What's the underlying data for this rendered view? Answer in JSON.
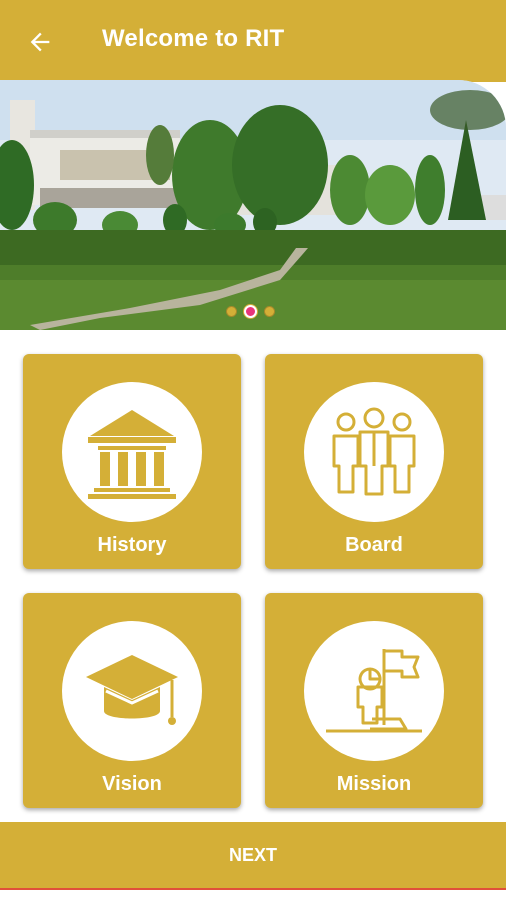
{
  "appbar": {
    "title": "Welcome to RIT",
    "back_icon": "arrow-left-icon",
    "color": "#d4af37"
  },
  "carousel": {
    "page_count": 3,
    "active_index": 1,
    "active_color": "#e8357a"
  },
  "cards": [
    {
      "label": "History",
      "icon": "building-columns-icon"
    },
    {
      "label": "Board",
      "icon": "people-group-icon"
    },
    {
      "label": "Vision",
      "icon": "graduation-cap-icon"
    },
    {
      "label": "Mission",
      "icon": "person-flag-icon"
    }
  ],
  "footer": {
    "next_label": "NEXT"
  }
}
